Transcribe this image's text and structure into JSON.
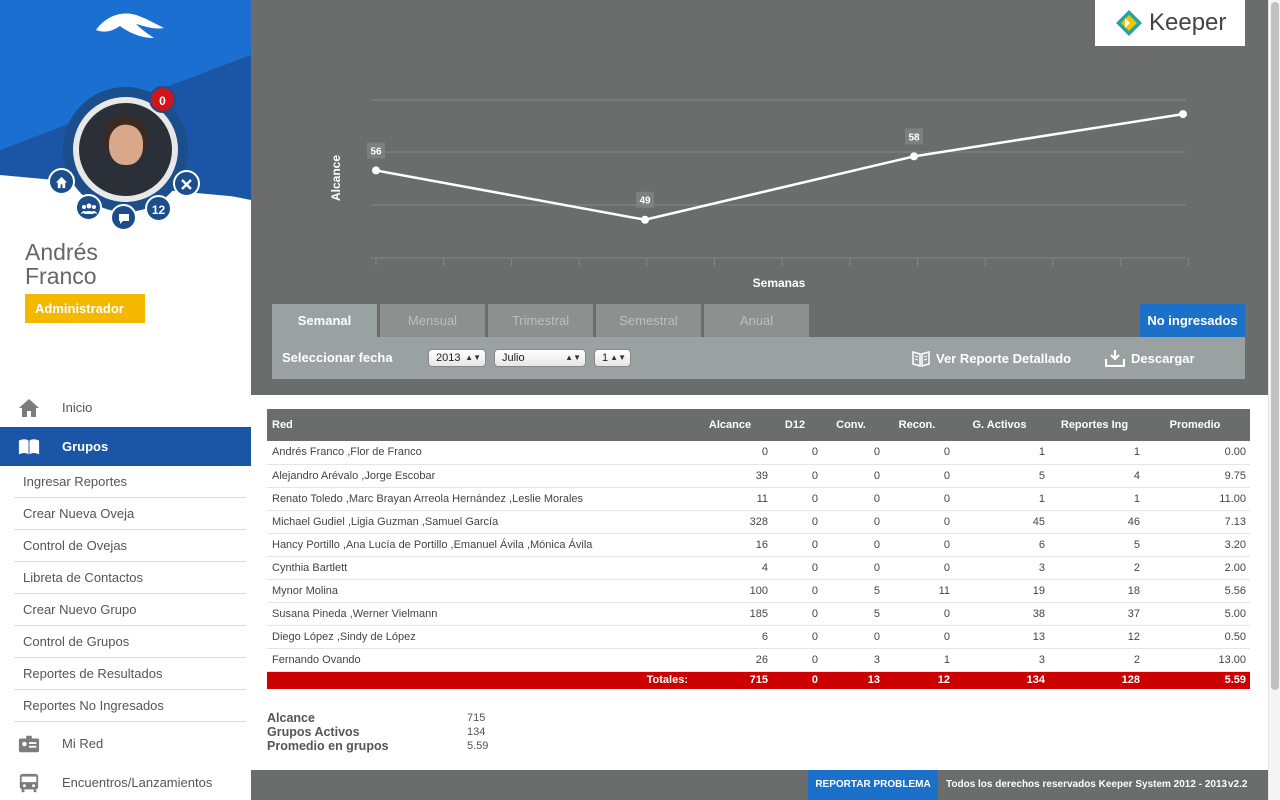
{
  "user": {
    "first_name": "Andrés",
    "last_name": "Franco",
    "role": "Administrador",
    "notifications": "0",
    "groups_count": "12"
  },
  "nav": {
    "inicio": "Inicio",
    "grupos": "Grupos",
    "sub_items": [
      "Ingresar Reportes",
      "Crear Nueva Oveja",
      "Control de Ovejas",
      "Libreta de Contactos",
      "Crear Nuevo Grupo",
      "Control de Grupos",
      "Reportes de Resultados",
      "Reportes No Ingresados"
    ],
    "mi_red": "Mi Red",
    "encuentros": "Encuentros/Lanzamientos"
  },
  "brand": {
    "name": "Keeper"
  },
  "chart_data": {
    "type": "line",
    "ylabel": "Alcance",
    "xlabel": "Semanas",
    "points": [
      {
        "value": 56,
        "label": "56"
      },
      {
        "value": 49,
        "label": "49"
      },
      {
        "value": 58,
        "label": "58"
      },
      {
        "value": 64,
        "label": ""
      }
    ],
    "ylim": [
      43,
      66
    ],
    "grid": true,
    "line_color": "#ffffff"
  },
  "tabs": [
    "Semanal",
    "Mensual",
    "Trimestral",
    "Semestral",
    "Anual"
  ],
  "active_tab": "Semanal",
  "no_ingresados": "No ingresados",
  "filter": {
    "label": "Seleccionar fecha",
    "year": "2013",
    "month": "Julio",
    "day": "1",
    "view_report": "Ver Reporte Detallado",
    "download": "Descargar"
  },
  "table": {
    "headers": [
      "Red",
      "Alcance",
      "D12",
      "Conv.",
      "Recon.",
      "G. Activos",
      "Reportes Ing",
      "Promedio"
    ],
    "rows": [
      [
        "Andrés Franco ,Flor de Franco",
        "0",
        "0",
        "0",
        "0",
        "1",
        "1",
        "0.00"
      ],
      [
        "Alejandro Arévalo ,Jorge Escobar",
        "39",
        "0",
        "0",
        "0",
        "5",
        "4",
        "9.75"
      ],
      [
        "Renato Toledo ,Marc Brayan Arreola Hernández ,Leslie Morales",
        "11",
        "0",
        "0",
        "0",
        "1",
        "1",
        "11.00"
      ],
      [
        "Michael Gudiel ,Ligia Guzman ,Samuel García",
        "328",
        "0",
        "0",
        "0",
        "45",
        "46",
        "7.13"
      ],
      [
        "Hancy Portillo ,Ana Lucía de Portillo ,Emanuel Ávila ,Mónica Ávila",
        "16",
        "0",
        "0",
        "0",
        "6",
        "5",
        "3.20"
      ],
      [
        "Cynthia Bartlett",
        "4",
        "0",
        "0",
        "0",
        "3",
        "2",
        "2.00"
      ],
      [
        "Mynor Molina",
        "100",
        "0",
        "5",
        "11",
        "19",
        "18",
        "5.56"
      ],
      [
        "Susana Pineda ,Werner Vielmann",
        "185",
        "0",
        "5",
        "0",
        "38",
        "37",
        "5.00"
      ],
      [
        "Diego López ,Sindy de López",
        "6",
        "0",
        "0",
        "0",
        "13",
        "12",
        "0.50"
      ],
      [
        "Fernando Ovando",
        "26",
        "0",
        "3",
        "1",
        "3",
        "2",
        "13.00"
      ]
    ],
    "totals_label": "Totales:",
    "totals": [
      "715",
      "0",
      "13",
      "12",
      "134",
      "128",
      "5.59"
    ]
  },
  "summary": [
    {
      "label": "Alcance",
      "value": "715"
    },
    {
      "label": "Grupos Activos",
      "value": "134"
    },
    {
      "label": "Promedio en grupos",
      "value": "5.59"
    }
  ],
  "footer": {
    "report_problem": "REPORTAR PROBLEMA",
    "copyright": "Todos los derechos reservados Keeper System 2012 - 2013",
    "version": "v2.2"
  },
  "colors": {
    "primary_blue": "#1b56a6",
    "accent_yellow": "#f5b800",
    "totals_red": "#cc0000",
    "panel_gray": "#6b6d6d"
  }
}
